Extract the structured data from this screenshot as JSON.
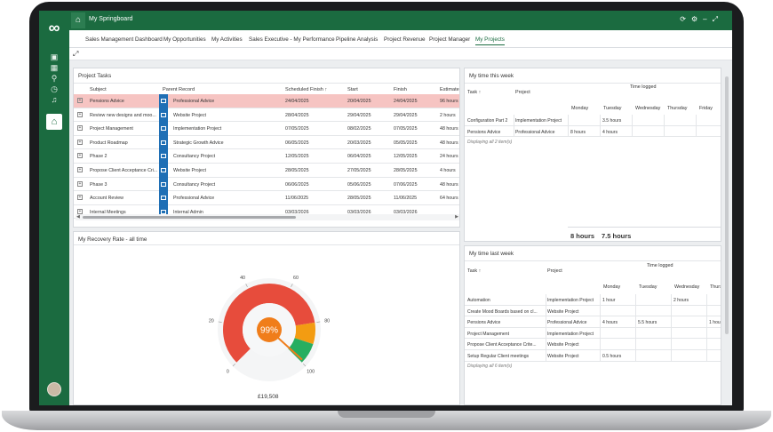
{
  "header": {
    "app_title": "My Springboard",
    "actions": [
      "refresh-icon",
      "gear-icon",
      "minimize-icon",
      "fullscreen-icon"
    ]
  },
  "tabs": [
    {
      "label": "Sales Management Dashboard"
    },
    {
      "label": "My Opportunities"
    },
    {
      "label": "My Activities"
    },
    {
      "label": "Sales Executive - My Performance"
    },
    {
      "label": "Pipeline Analysis"
    },
    {
      "label": "Project Revenue"
    },
    {
      "label": "Project Manager"
    },
    {
      "label": "My Projects",
      "active": true
    }
  ],
  "project_tasks": {
    "title": "Project Tasks",
    "columns": [
      "Subject",
      "Parent Record",
      "Scheduled Finish",
      "Start",
      "Finish",
      "Estimate"
    ],
    "rows": [
      {
        "subject": "Pensions Advice",
        "parent": "Professional Advice",
        "scheduled": "24/04/2025",
        "start": "20/04/2025",
        "finish": "24/04/2025",
        "estimate": "96 hours",
        "highlight": true
      },
      {
        "subject": "Review new designs and moo...",
        "parent": "Website Project",
        "scheduled": "28/04/2025",
        "start": "29/04/2025",
        "finish": "29/04/2025",
        "estimate": "2 hours"
      },
      {
        "subject": "Project Management",
        "parent": "Implementation Project",
        "scheduled": "07/05/2025",
        "start": "08/02/2025",
        "finish": "07/05/2025",
        "estimate": "48 hours"
      },
      {
        "subject": "Product Roadmap",
        "parent": "Strategic Growth Advice",
        "scheduled": "06/05/2025",
        "start": "20/03/2025",
        "finish": "05/05/2025",
        "estimate": "48 hours"
      },
      {
        "subject": "Phase 2",
        "parent": "Consultancy Project",
        "scheduled": "12/05/2025",
        "start": "06/04/2025",
        "finish": "12/05/2025",
        "estimate": "24 hours"
      },
      {
        "subject": "Propose Client Acceptance Cri...",
        "parent": "Website Project",
        "scheduled": "28/05/2025",
        "start": "27/05/2025",
        "finish": "28/05/2025",
        "estimate": "4 hours"
      },
      {
        "subject": "Phase 3",
        "parent": "Consultancy Project",
        "scheduled": "06/06/2025",
        "start": "05/06/2025",
        "finish": "07/06/2025",
        "estimate": "48 hours"
      },
      {
        "subject": "Account Review",
        "parent": "Professional Advice",
        "scheduled": "11/06/2025",
        "start": "28/05/2025",
        "finish": "11/06/2025",
        "estimate": "64 hours"
      },
      {
        "subject": "Internal Meetings",
        "parent": "Internal Admin",
        "scheduled": "03/03/2026",
        "start": "03/03/2026",
        "finish": "03/03/2026",
        "estimate": ""
      }
    ],
    "scroll_left": "◀",
    "scroll_right": "▶"
  },
  "this_week": {
    "title": "My time this week",
    "time_logged_label": "Time logged",
    "task_label": "Task ↑",
    "project_label": "Project",
    "days": [
      "Monday",
      "Tuesday",
      "Wednesday",
      "Thursday",
      "Friday"
    ],
    "rows": [
      {
        "task": "Configuration Part 2",
        "project": "Implementation Project",
        "values": [
          "",
          "3.5 hours",
          "",
          "",
          ""
        ]
      },
      {
        "task": "Pensions Advice",
        "project": "Professional Advice",
        "values": [
          "8 hours",
          "4 hours",
          "",
          "",
          ""
        ]
      }
    ],
    "footnote": "Displaying all 2 item(s)",
    "totals": [
      "8 hours",
      "7.5 hours"
    ]
  },
  "last_week": {
    "title": "My time last week",
    "time_logged_label": "Time logged",
    "task_label": "Task ↑",
    "project_label": "Project",
    "days": [
      "Monday",
      "Tuesday",
      "Wednesday",
      "Thursda"
    ],
    "rows": [
      {
        "task": "Automation",
        "project": "Implementation Project",
        "values": [
          "1 hour",
          "",
          "2 hours",
          ""
        ]
      },
      {
        "task": "Create Mood Boards based on cl...",
        "project": "Website Project",
        "values": [
          "",
          "",
          "",
          ""
        ]
      },
      {
        "task": "Pensions Advice",
        "project": "Professional Advice",
        "values": [
          "4 hours",
          "5.5 hours",
          "",
          "1 hour"
        ]
      },
      {
        "task": "Project Management",
        "project": "Implementation Project",
        "values": [
          "",
          "",
          "",
          ""
        ]
      },
      {
        "task": "Propose Client Acceptance Crite...",
        "project": "Website Project",
        "values": [
          "",
          "",
          "",
          ""
        ]
      },
      {
        "task": "Setup Regular Client meetings",
        "project": "Website Project",
        "values": [
          "0.5 hours",
          "",
          "",
          ""
        ]
      }
    ],
    "footnote": "Displaying all 6 item(s)"
  },
  "recovery": {
    "title": "My Recovery Rate - all time",
    "value_label": "99%",
    "value": 99,
    "scale_labels": [
      "0",
      "20",
      "40",
      "60",
      "80",
      "100"
    ],
    "amount": "£19,508",
    "colors": {
      "red": "#e74c3c",
      "orange": "#f39c12",
      "green": "#27ae60",
      "needle": "#f07d1a"
    }
  }
}
